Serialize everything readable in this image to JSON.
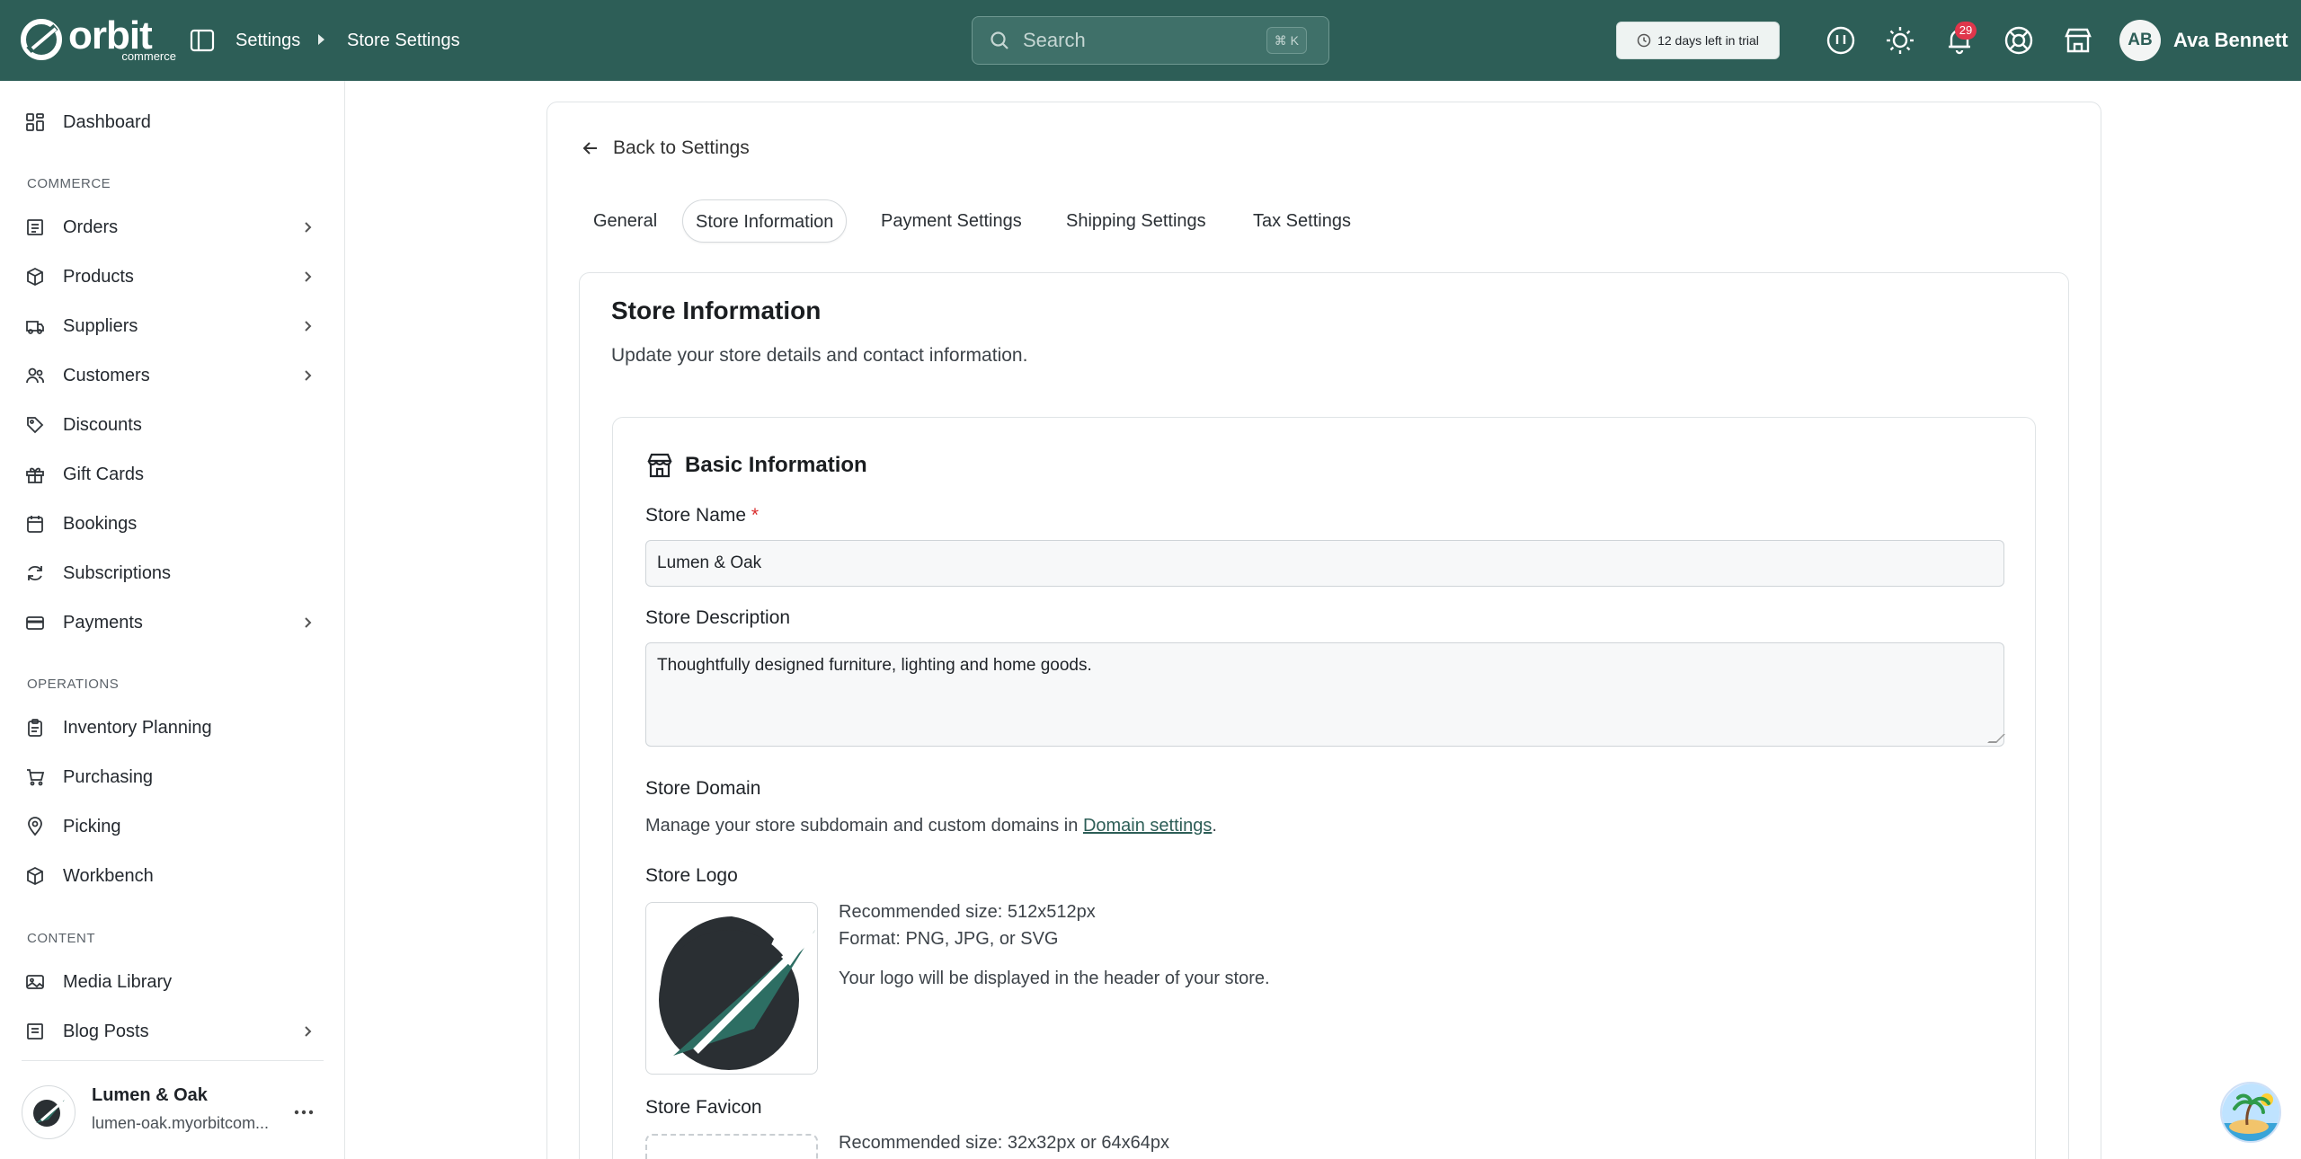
{
  "header": {
    "brand": "orbit",
    "brand_sub": "commerce",
    "breadcrumb": [
      "Settings",
      "Store Settings"
    ],
    "search_placeholder": "Search",
    "search_shortcut": "⌘ K",
    "trial_text": "12 days left in trial",
    "notifications_count": "29",
    "user_initials": "AB",
    "user_name": "Ava Bennett",
    "brand_color": "#2d5e57"
  },
  "sidebar": {
    "top_items": [
      {
        "label": "Dashboard",
        "icon": "dashboard-icon"
      }
    ],
    "sections": [
      {
        "title": "COMMERCE",
        "items": [
          {
            "label": "Orders",
            "icon": "orders-icon",
            "expandable": true
          },
          {
            "label": "Products",
            "icon": "products-icon",
            "expandable": true
          },
          {
            "label": "Suppliers",
            "icon": "suppliers-icon",
            "expandable": true
          },
          {
            "label": "Customers",
            "icon": "customers-icon",
            "expandable": true
          },
          {
            "label": "Discounts",
            "icon": "tag-icon",
            "expandable": false
          },
          {
            "label": "Gift Cards",
            "icon": "gift-icon",
            "expandable": false
          },
          {
            "label": "Bookings",
            "icon": "calendar-icon",
            "expandable": false
          },
          {
            "label": "Subscriptions",
            "icon": "refresh-icon",
            "expandable": false
          },
          {
            "label": "Payments",
            "icon": "credit-card-icon",
            "expandable": true
          }
        ]
      },
      {
        "title": "OPERATIONS",
        "items": [
          {
            "label": "Inventory Planning",
            "icon": "clipboard-icon",
            "expandable": false
          },
          {
            "label": "Purchasing",
            "icon": "cart-icon",
            "expandable": false
          },
          {
            "label": "Picking",
            "icon": "map-pin-icon",
            "expandable": false
          },
          {
            "label": "Workbench",
            "icon": "box-icon",
            "expandable": false
          }
        ]
      },
      {
        "title": "CONTENT",
        "items": [
          {
            "label": "Media Library",
            "icon": "image-icon",
            "expandable": false
          },
          {
            "label": "Blog Posts",
            "icon": "blog-icon",
            "expandable": true
          }
        ]
      }
    ],
    "store": {
      "name": "Lumen & Oak",
      "url": "lumen-oak.myorbitcom..."
    }
  },
  "main": {
    "back_label": "Back to Settings",
    "tabs": [
      {
        "label": "General",
        "active": false
      },
      {
        "label": "Store Information",
        "active": true
      },
      {
        "label": "Payment Settings",
        "active": false
      },
      {
        "label": "Shipping Settings",
        "active": false
      },
      {
        "label": "Tax Settings",
        "active": false
      }
    ],
    "section_title": "Store Information",
    "section_subtitle": "Update your store details and contact information.",
    "basic_title": "Basic Information",
    "store_name_label": "Store Name",
    "required_mark": "*",
    "store_name_value": "Lumen & Oak",
    "description_label": "Store Description",
    "description_value": "Thoughtfully designed furniture, lighting and home goods.",
    "domain_label": "Store Domain",
    "domain_help_prefix": "Manage your store subdomain and custom domains in ",
    "domain_help_link": "Domain settings",
    "domain_help_suffix": ".",
    "logo_label": "Store Logo",
    "logo_size": "Recommended size: 512x512px",
    "logo_format": "Format: PNG, JPG, or SVG",
    "logo_note": "Your logo will be displayed in the header of your store.",
    "favicon_label": "Store Favicon",
    "favicon_size": "Recommended size: 32x32px or 64x64px"
  }
}
